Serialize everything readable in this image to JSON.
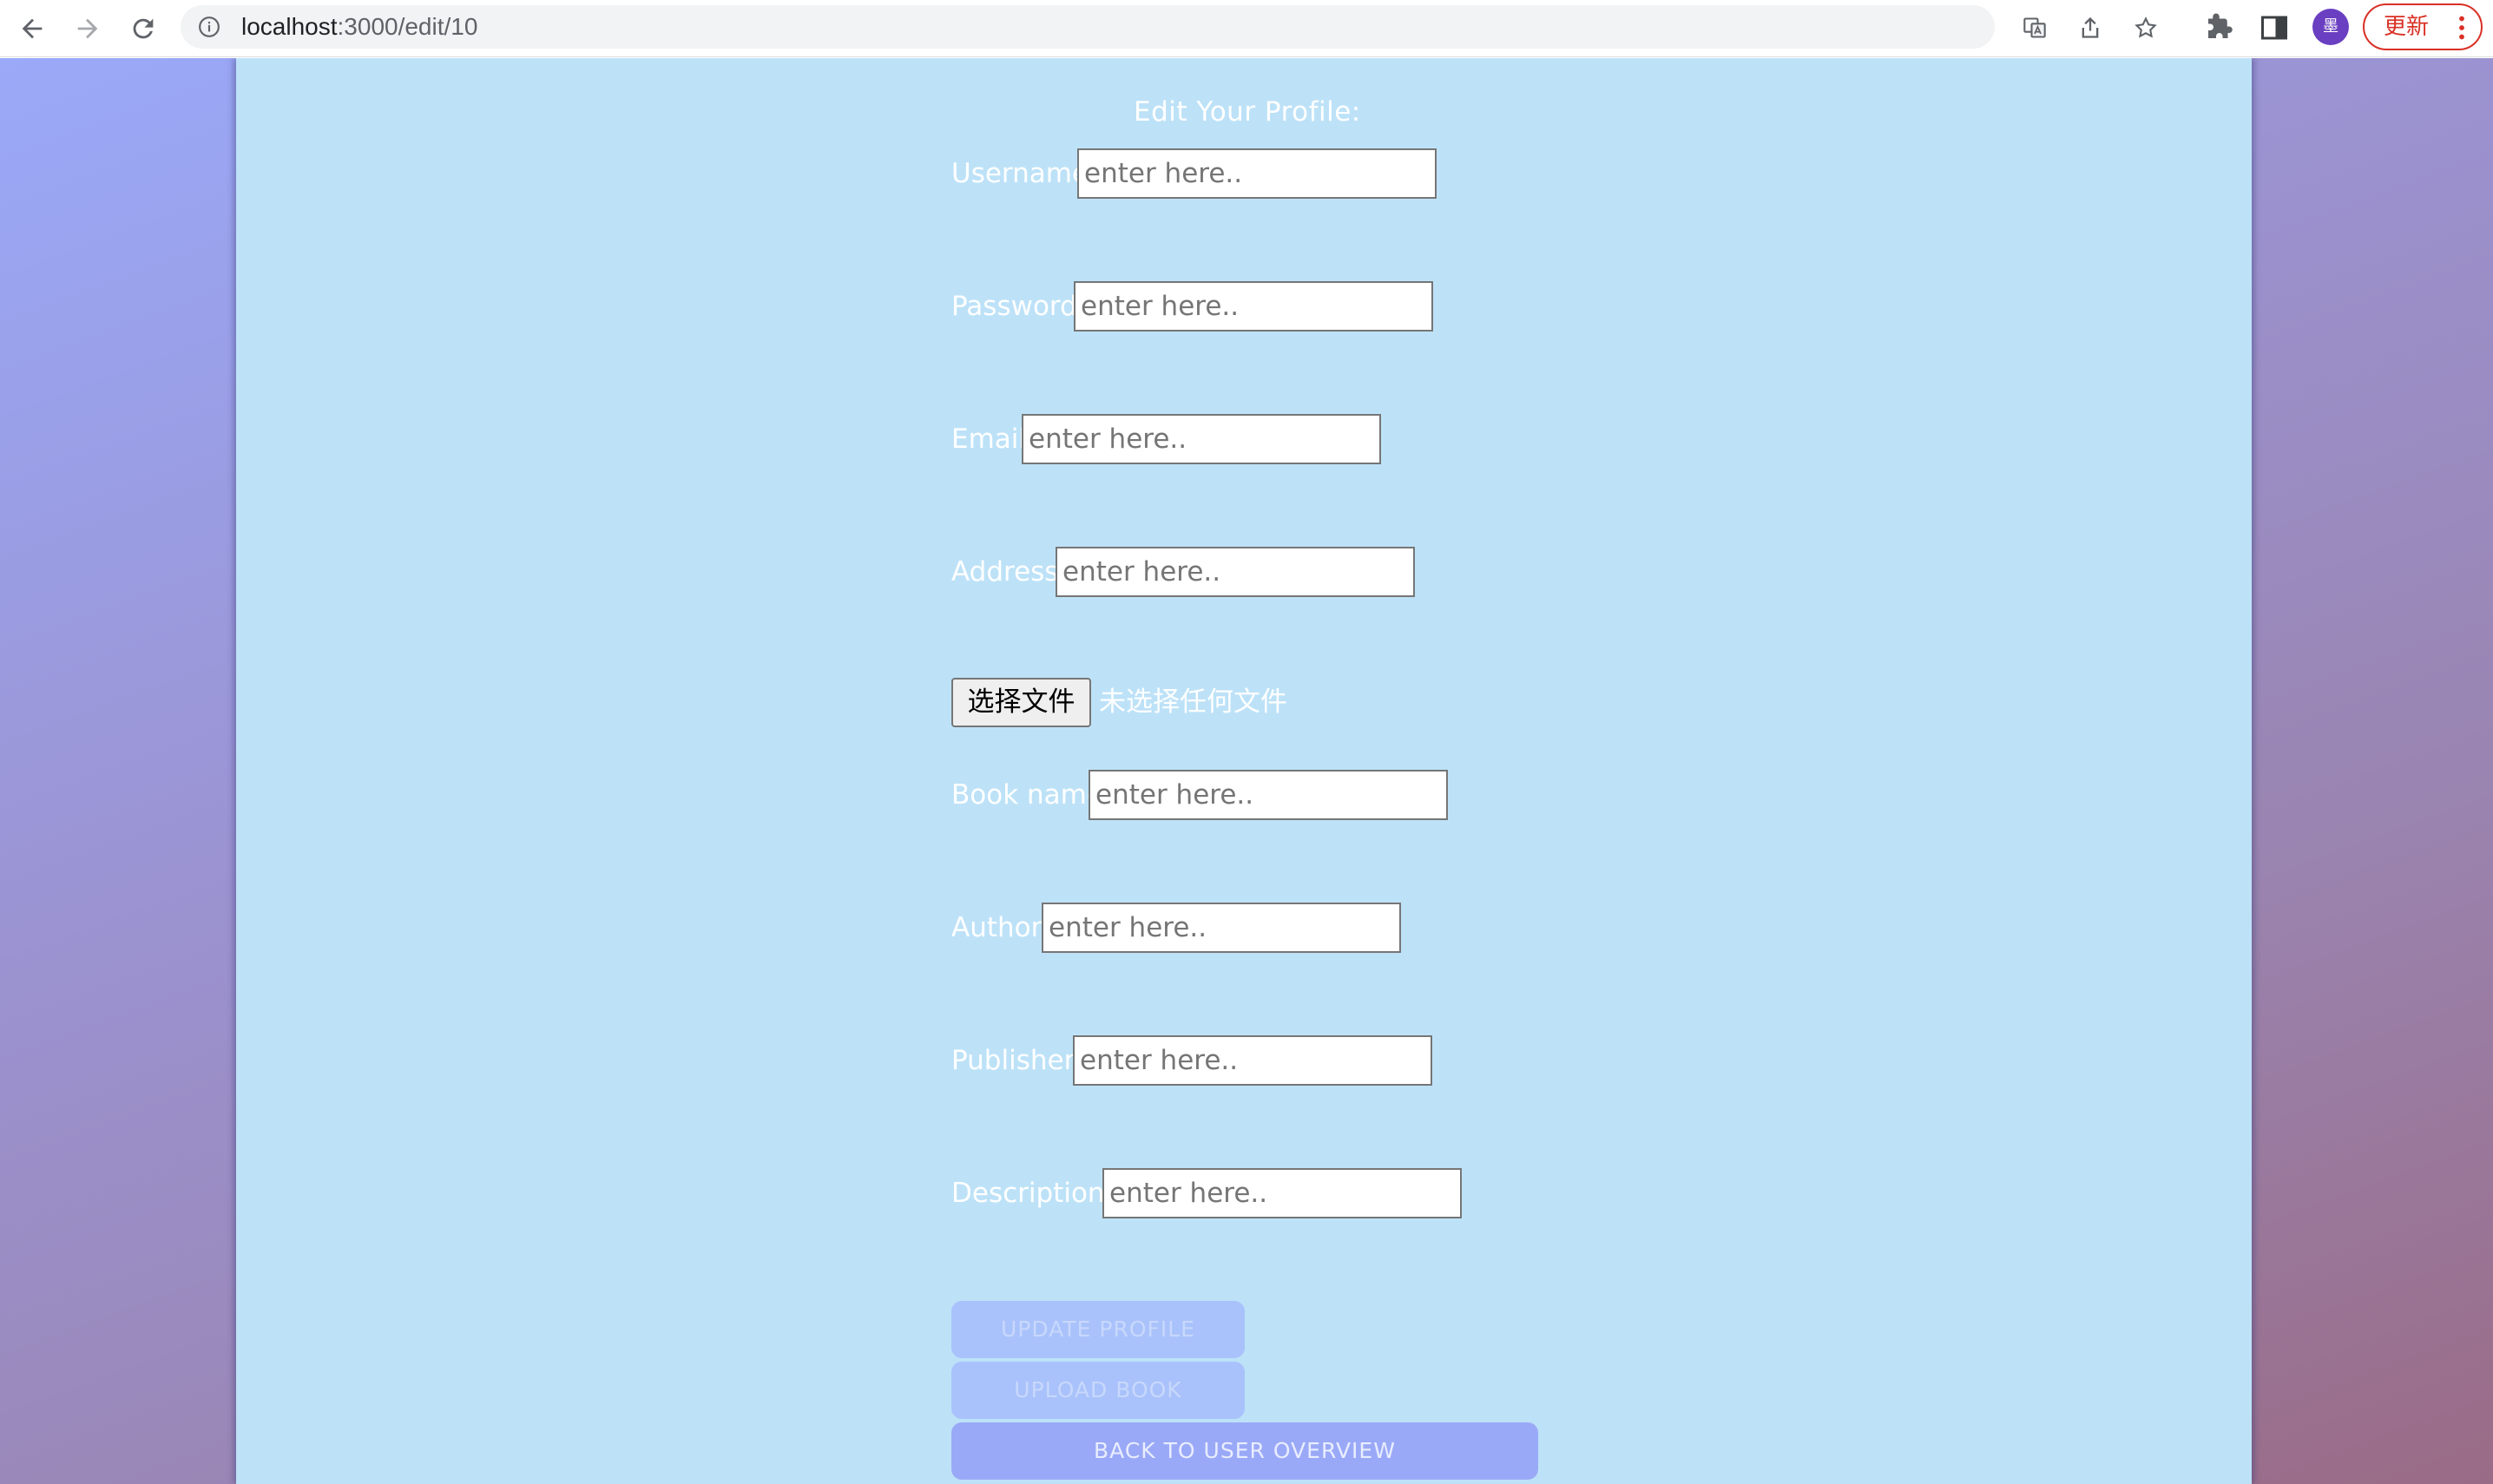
{
  "browser": {
    "url_host": "localhost",
    "url_path": ":3000/edit/10",
    "avatar_text": "墨",
    "update_label": "更新"
  },
  "page": {
    "title": "Edit Your Profile:",
    "fields": [
      {
        "label": "Username",
        "placeholder": "enter here.."
      },
      {
        "label": "Password",
        "placeholder": "enter here.."
      },
      {
        "label": "Email",
        "placeholder": "enter here.."
      },
      {
        "label": "Address",
        "placeholder": "enter here.."
      },
      {
        "label": "Book name",
        "placeholder": "enter here.."
      },
      {
        "label": "Author",
        "placeholder": "enter here.."
      },
      {
        "label": "Publisher",
        "placeholder": "enter here.."
      },
      {
        "label": "Description",
        "placeholder": "enter here.."
      }
    ],
    "file": {
      "button_label": "选择文件",
      "status": "未选择任何文件"
    },
    "buttons": {
      "update_profile": "UPDATE PROFILE",
      "upload_book": "UPLOAD BOOK",
      "back": "BACK TO USER OVERVIEW"
    }
  }
}
